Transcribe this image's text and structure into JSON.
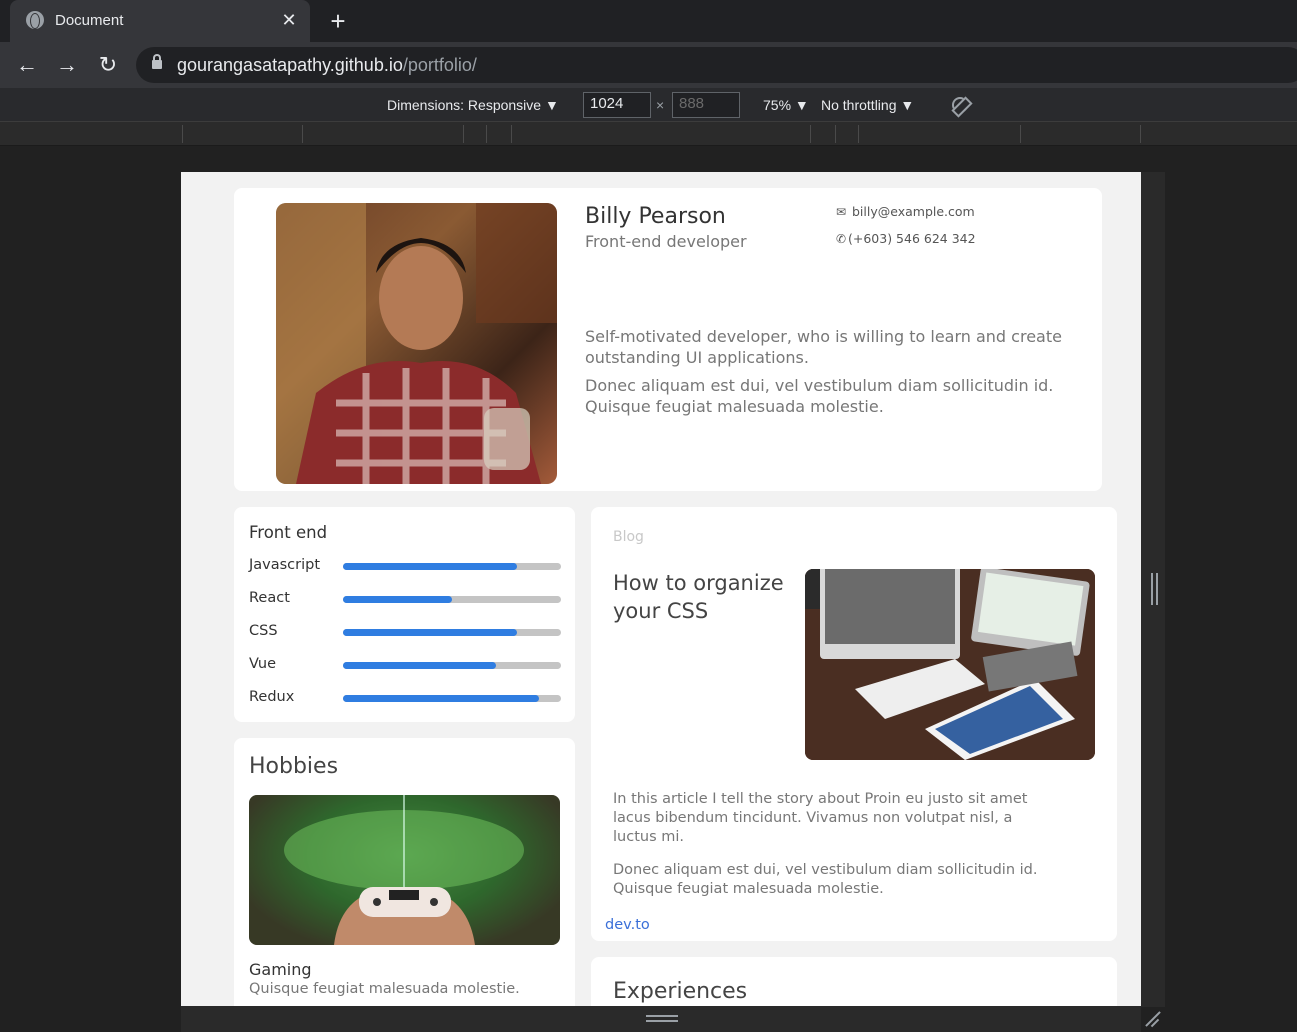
{
  "browser": {
    "tab_title": "Document",
    "tab_close": "✕",
    "new_tab": "+",
    "url_host": "gourangasatapathy.github.io",
    "url_path": "/portfolio/"
  },
  "devtools": {
    "dimensions_label": "Dimensions: Responsive ▼",
    "width": "1024",
    "height_placeholder": "888",
    "times": "×",
    "zoom": "75% ▼",
    "throttling": "No throttling ▼"
  },
  "profile": {
    "name": "Billy Pearson",
    "role": "Front-end developer",
    "email": "billy@example.com",
    "phone": "(+603) 546 624 342",
    "bio_1": "Self-motivated developer, who is willing to learn and create outstanding UI applications.",
    "bio_2": "Donec aliquam est dui, vel vestibulum diam sollicitudin id. Quisque feugiat malesuada molestie."
  },
  "skills": {
    "title": "Front end",
    "items": [
      {
        "label": "Javascript",
        "level": 0.8
      },
      {
        "label": "React",
        "level": 0.5
      },
      {
        "label": "CSS",
        "level": 0.8
      },
      {
        "label": "Vue",
        "level": 0.7
      },
      {
        "label": "Redux",
        "level": 0.9
      }
    ]
  },
  "hobbies": {
    "title": "Hobbies",
    "item_name": "Gaming",
    "item_desc": "Quisque feugiat malesuada molestie."
  },
  "blog": {
    "kicker": "Blog",
    "title": "How to organize your CSS",
    "text_1": "In this article I tell the story about Proin eu justo sit amet lacus bibendum tincidunt. Vivamus non volutpat nisl, a luctus mi.",
    "text_2": "Donec aliquam est dui, vel vestibulum diam sollicitudin id. Quisque feugiat malesuada molestie.",
    "link": "dev.to"
  },
  "experiences": {
    "title": "Experiences"
  },
  "colors": {
    "accent": "#2f7de1",
    "link": "#3a6fd8"
  }
}
